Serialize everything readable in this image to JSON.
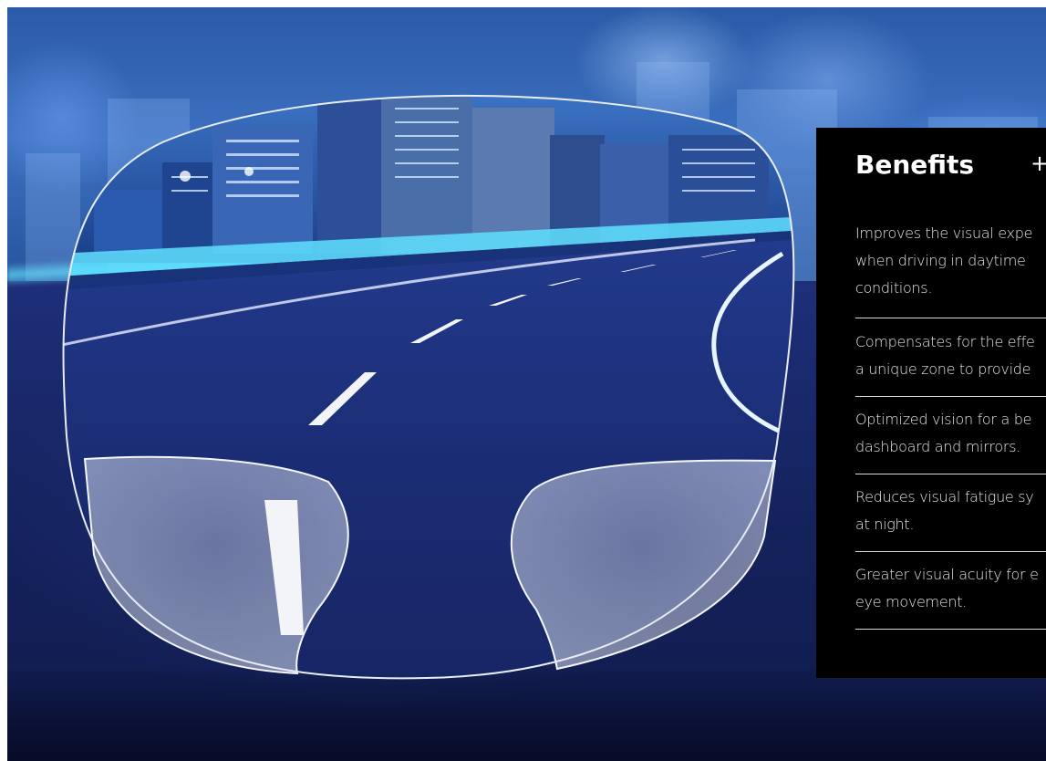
{
  "panel": {
    "title": "Benefits",
    "toggle": "+",
    "benefits": [
      {
        "line1": "Improves the visual expe",
        "line2": "when driving in daytime",
        "line3": "conditions."
      },
      {
        "line1": "Compensates for the effe",
        "line2": "a unique zone to provide"
      },
      {
        "line1": "Optimized vision for a be",
        "line2": "dashboard and mirrors."
      },
      {
        "line1": "Reduces visual fatigue sy",
        "line2": "at night."
      },
      {
        "line1": "Greater visual acuity for e",
        "line2": "eye movement."
      }
    ]
  },
  "image": {
    "subject": "driving lens over night highway with city skyline",
    "colors": {
      "panel_bg": "#000000",
      "panel_text": "#e6e6e6",
      "accent_glow": "#64e6ff"
    }
  }
}
